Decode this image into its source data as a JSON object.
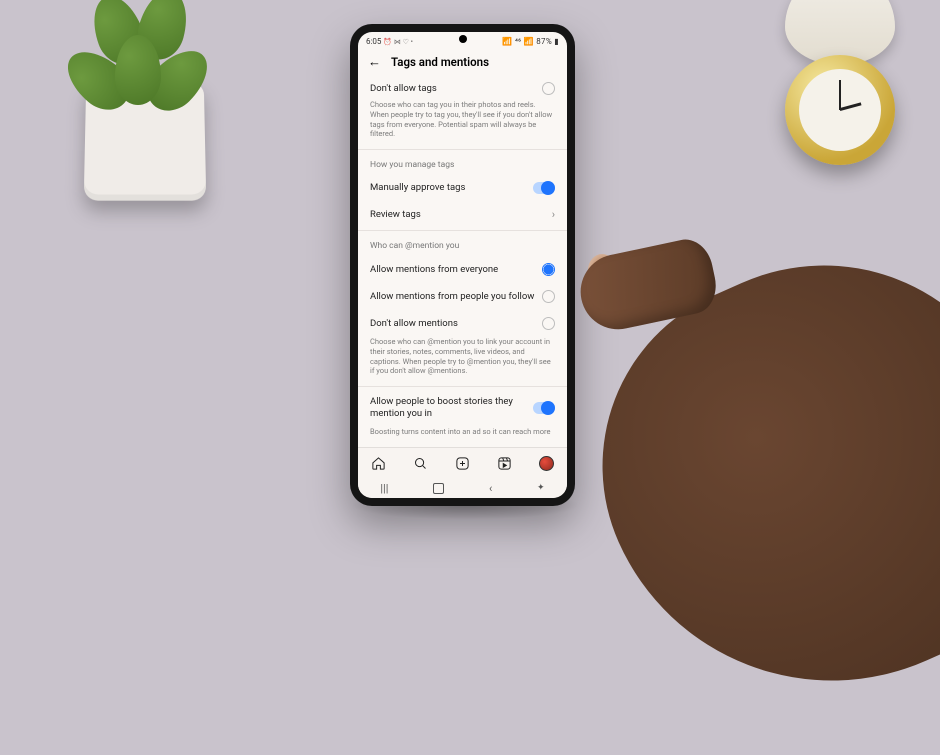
{
  "status": {
    "time": "6:05",
    "left_extra": "⏰ ⋈ ♡ •",
    "right": "📶 ⁴⁶ 📶 87% ▮"
  },
  "header": {
    "title": "Tags and mentions"
  },
  "tags_section": {
    "dont_allow": "Don't allow tags",
    "desc": "Choose who can tag you in their photos and reels. When people try to tag you, they'll see if you don't allow tags from everyone. Potential spam will always be filtered."
  },
  "manage": {
    "label": "How you manage tags",
    "approve": "Manually approve tags",
    "review": "Review tags"
  },
  "mentions": {
    "label": "Who can @mention you",
    "everyone": "Allow mentions from everyone",
    "followed": "Allow mentions from people you follow",
    "none": "Don't allow mentions",
    "desc": "Choose who can @mention you to link your account in their stories, notes, comments, live videos, and captions. When people try to @mention you, they'll see if you don't allow @mentions."
  },
  "boost": {
    "label": "Allow people to boost stories they mention you in",
    "desc": "Boosting turns content into an ad so it can reach more"
  }
}
